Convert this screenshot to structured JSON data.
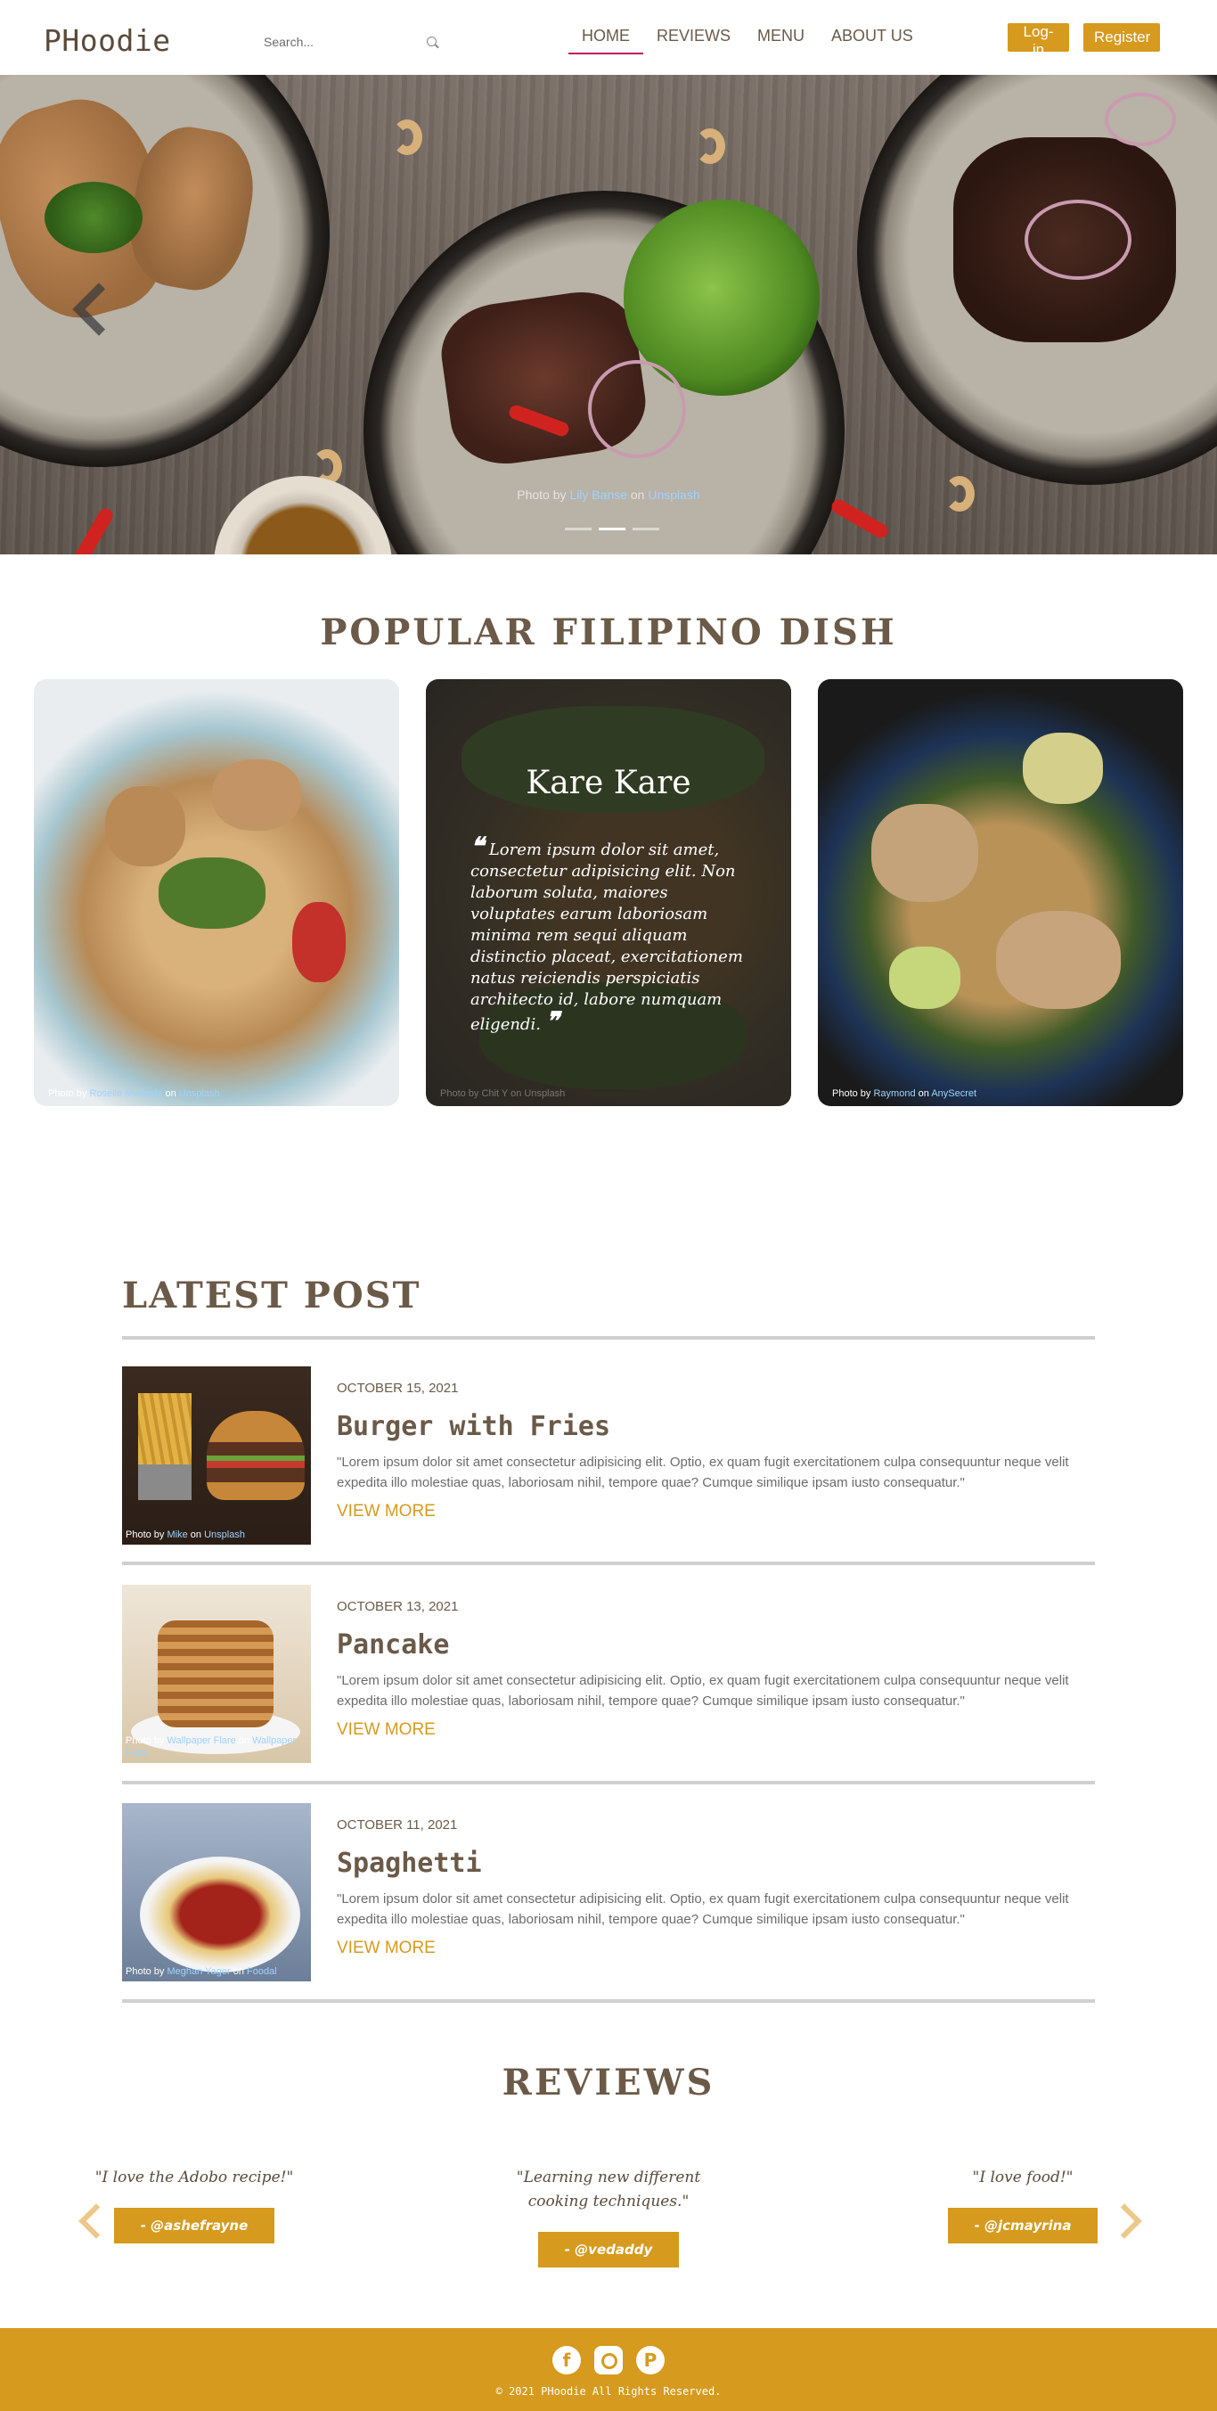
{
  "nav": {
    "brand": "PHoodie",
    "search_placeholder": "Search...",
    "menu": [
      "HOME",
      "REVIEWS",
      "MENU",
      "ABOUT US"
    ],
    "login": "Log-in",
    "register": "Register"
  },
  "hero": {
    "credit_prefix": "Photo by ",
    "credit_author": "Lily Banse",
    "credit_mid": " on ",
    "credit_site": "Unsplash",
    "slides": 3,
    "active_slide": 1
  },
  "popular": {
    "title": "POPULAR FILIPINO DISH",
    "cards": [
      {
        "credit_prefix": "Photo by ",
        "credit_author": "Roselle Melanda",
        "credit_mid": " on ",
        "credit_site": "Unsplash"
      },
      {
        "title": "Kare Kare",
        "quote": "Lorem ipsum dolor sit amet, consectetur adipisicing elit. Non laborum soluta, maiores voluptates earum laboriosam minima rem sequi aliquam distinctio placeat, exercitationem natus reiciendis perspiciatis architecto id, labore numquam eligendi.",
        "credit": "Photo by Chit Y on Unsplash"
      },
      {
        "credit_prefix": "Photo by ",
        "credit_author": "Raymond",
        "credit_mid": " on ",
        "credit_site": "AnySecret"
      }
    ]
  },
  "latest": {
    "title": "LATEST POST",
    "posts": [
      {
        "date": "OCTOBER 15, 2021",
        "title": "Burger with Fries",
        "excerpt": "\"Lorem ipsum dolor sit amet consectetur adipisicing elit. Optio, ex quam fugit exercitationem culpa consequuntur neque velit expedita illo molestiae quas, laboriosam nihil, tempore quae? Cumque similique ipsam iusto consequatur.\"",
        "more": "VIEW MORE",
        "credit_prefix": "Photo by ",
        "credit_author": "Mike",
        "credit_mid": " on ",
        "credit_site": "Unsplash"
      },
      {
        "date": "OCTOBER 13, 2021",
        "title": "Pancake",
        "excerpt": "\"Lorem ipsum dolor sit amet consectetur adipisicing elit. Optio, ex quam fugit exercitationem culpa consequuntur neque velit expedita illo molestiae quas, laboriosam nihil, tempore quae? Cumque similique ipsam iusto consequatur.\"",
        "more": "VIEW MORE",
        "credit_prefix": "Photo by ",
        "credit_author": "Wallpaper Flare",
        "credit_mid": " on ",
        "credit_site": "Wallpaper Flare"
      },
      {
        "date": "OCTOBER 11, 2021",
        "title": "Spaghetti",
        "excerpt": "\"Lorem ipsum dolor sit amet consectetur adipisicing elit. Optio, ex quam fugit exercitationem culpa consequuntur neque velit expedita illo molestiae quas, laboriosam nihil, tempore quae? Cumque similique ipsam iusto consequatur.\"",
        "more": "VIEW MORE",
        "credit_prefix": "Photo by ",
        "credit_author": "Meghan Yager",
        "credit_mid": " on ",
        "credit_site": "Foodal"
      }
    ]
  },
  "reviews": {
    "title": "REVIEWS",
    "items": [
      {
        "quote": "\"I love the Adobo recipe!\"",
        "author": "-   @ashefrayne"
      },
      {
        "quote": "\"Learning new different cooking techniques.\"",
        "author": "-   @vedaddy"
      },
      {
        "quote": "\"I love food!\"",
        "author": "-   @jcmayrina"
      }
    ]
  },
  "footer": {
    "social_icons": [
      "facebook-icon",
      "instagram-icon",
      "pinterest-icon"
    ],
    "copyright": "© 2021 PHoodie All Rights Reserved."
  },
  "colors": {
    "accent": "#d69a1e",
    "text": "#6b5a48",
    "active_underline": "#c2185b"
  }
}
